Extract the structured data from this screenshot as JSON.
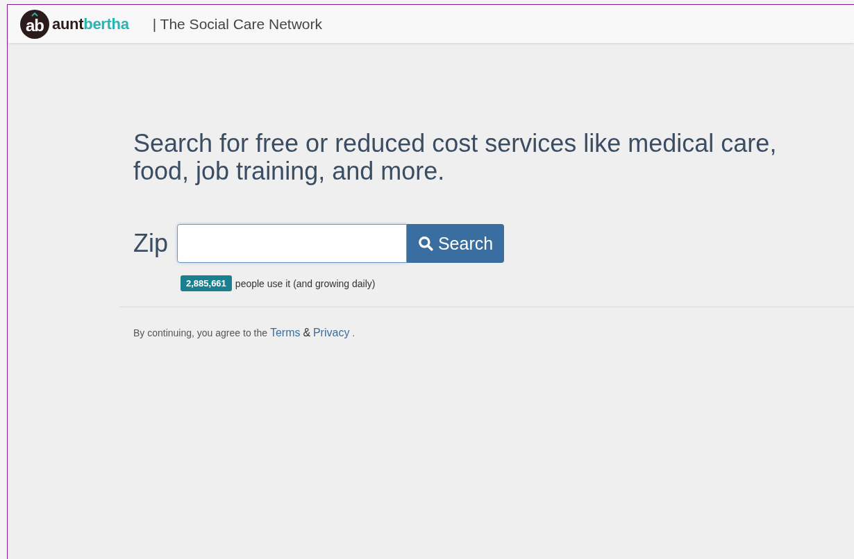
{
  "header": {
    "logo_mark": "ab",
    "brand_first": "aunt",
    "brand_second": "bertha",
    "tagline": "| The Social Care Network"
  },
  "hero": {
    "headline": "Search for free or reduced cost services like medical care, food, job training, and more."
  },
  "search": {
    "label": "Zip",
    "button": "Search"
  },
  "usage": {
    "count": "2,885,661",
    "text": "people use it (and growing daily)"
  },
  "agreement": {
    "before": "By continuing, you agree to the",
    "terms": "Terms",
    "and": "&",
    "privacy": "Privacy",
    "after": "."
  }
}
